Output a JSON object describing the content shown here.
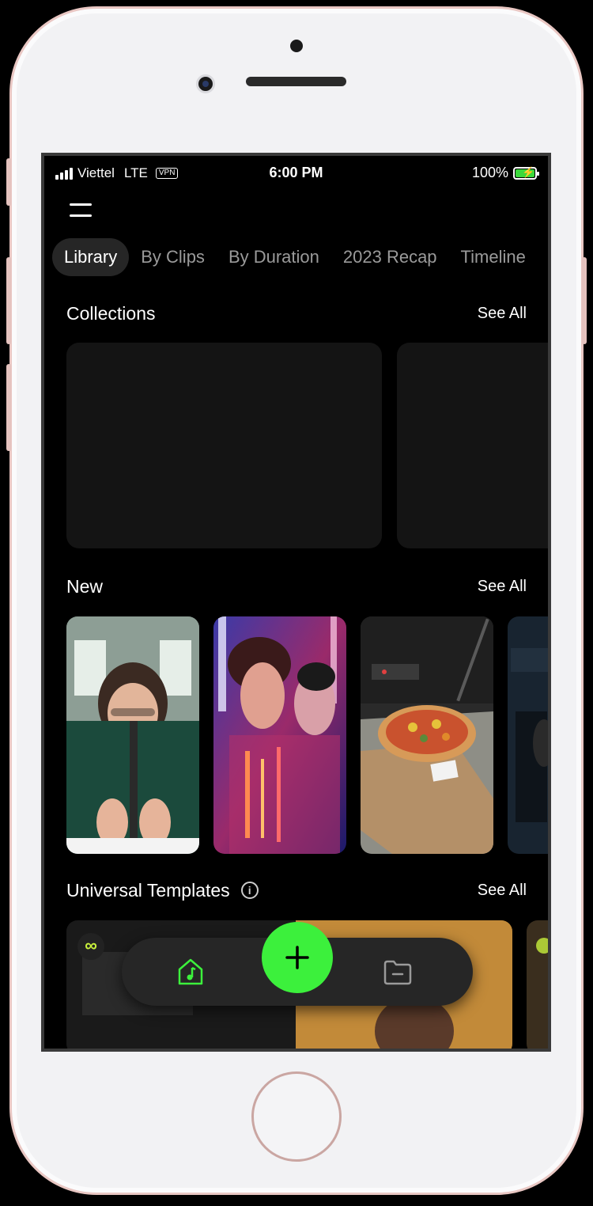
{
  "status_bar": {
    "carrier": "Viettel",
    "network": "LTE",
    "vpn": "VPN",
    "time": "6:00 PM",
    "battery": "100%"
  },
  "tabs": [
    {
      "label": "Library",
      "active": true
    },
    {
      "label": "By Clips",
      "active": false
    },
    {
      "label": "By Duration",
      "active": false
    },
    {
      "label": "2023 Recap",
      "active": false
    },
    {
      "label": "Timeline",
      "active": false
    }
  ],
  "sections": {
    "collections": {
      "title": "Collections",
      "see_all": "See All"
    },
    "new": {
      "title": "New",
      "see_all": "See All"
    },
    "templates": {
      "title": "Universal Templates",
      "see_all": "See All",
      "info_icon": "i"
    }
  },
  "template_badge": "∞",
  "colors": {
    "accent": "#3cf03c",
    "background": "#000000",
    "nav_bg": "#262626"
  },
  "icons": {
    "menu": "hamburger-menu-icon",
    "home": "music-home-icon",
    "add": "plus-icon",
    "folder": "folder-icon",
    "info": "info-icon"
  }
}
